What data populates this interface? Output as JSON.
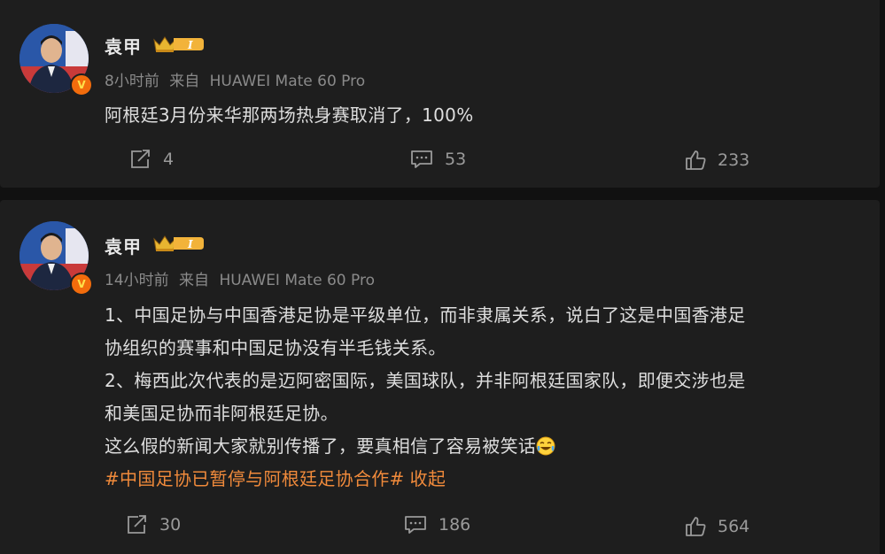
{
  "posts": [
    {
      "username": "袁甲",
      "level": "I",
      "verified_badge": "V",
      "time": "8小时前",
      "source_prefix": "来自",
      "source_device": "HUAWEI Mate 60 Pro",
      "lines": [
        "阿根廷3月份来华那两场热身赛取消了，100%"
      ],
      "actions": {
        "share": "4",
        "comment": "53",
        "like": "233"
      }
    },
    {
      "username": "袁甲",
      "level": "I",
      "verified_badge": "V",
      "time": "14小时前",
      "source_prefix": "来自",
      "source_device": "HUAWEI Mate 60 Pro",
      "lines": [
        "1、中国足协与中国香港足协是平级单位，而非隶属关系，说白了这是中国香港足",
        "协组织的赛事和中国足协没有半毛钱关系。",
        "2、梅西此次代表的是迈阿密国际，美国球队，并非阿根廷国家队，即便交涉也是",
        "和美国足协而非阿根廷足协。",
        "这么假的新闻大家就别传播了，要真相信了容易被笑话"
      ],
      "emoji": "laughing-crying-emoji",
      "topic": "#中国足协已暂停与阿根廷足协合作#",
      "collapse_label": "收起",
      "actions": {
        "share": "30",
        "comment": "186",
        "like": "564"
      }
    }
  ],
  "colors": {
    "background": "#111111",
    "card": "#1e1e1e",
    "text": "#dedede",
    "meta": "#8a8a8a",
    "accent": "#f08a3b",
    "verified": "#f26c0c"
  }
}
